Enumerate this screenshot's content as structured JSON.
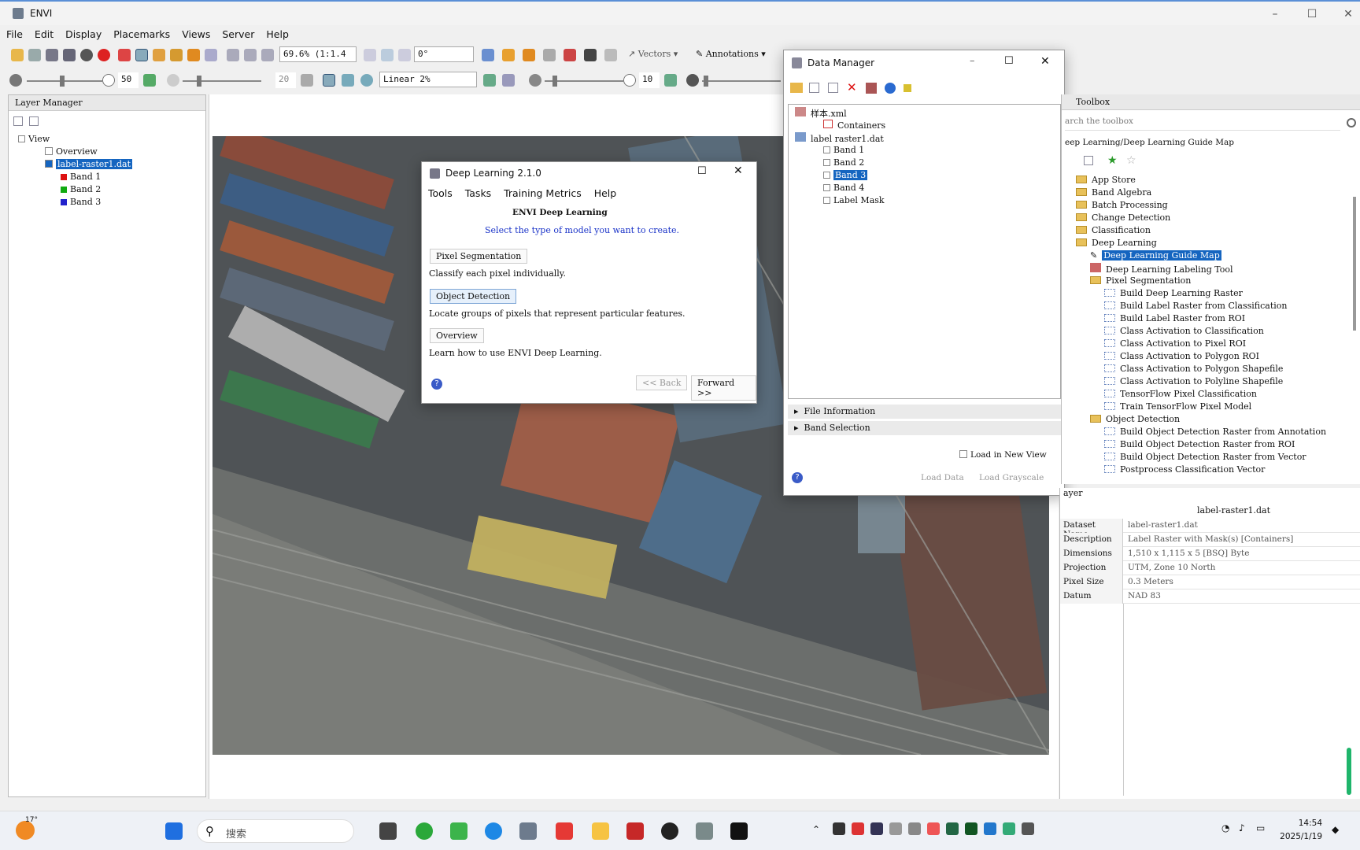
{
  "app": {
    "title": "ENVI"
  },
  "menu": [
    "File",
    "Edit",
    "Display",
    "Placemarks",
    "Views",
    "Server",
    "Help"
  ],
  "toolbar": {
    "zoom": "69.6% (1:1.4",
    "rotation": "0°",
    "vectors": "Vectors",
    "annotations": "Annotations",
    "brightness": "50",
    "contrast": "20",
    "stretch": "Linear 2%",
    "sharpen": "10"
  },
  "layer_manager": {
    "title": "Layer Manager",
    "items": [
      "View",
      "Overview",
      "label-raster1.dat",
      "Band 1",
      "Band 2",
      "Band 3"
    ],
    "band_colors": [
      "#d11",
      "#1a1",
      "#22c"
    ]
  },
  "deep_learning": {
    "title": "Deep Learning 2.1.0",
    "menu": [
      "Tools",
      "Tasks",
      "Training Metrics",
      "Help"
    ],
    "heading": "ENVI Deep Learning",
    "prompt": "Select the type of model you want to create.",
    "options": [
      {
        "label": "Pixel Segmentation",
        "desc": "Classify each pixel individually."
      },
      {
        "label": "Object Detection",
        "desc": "Locate groups of pixels that represent particular features."
      },
      {
        "label": "Overview",
        "desc": "Learn how to use ENVI Deep Learning."
      }
    ],
    "back": "<< Back",
    "forward": "Forward >>"
  },
  "data_manager": {
    "title": "Data Manager",
    "tree": [
      "样本.xml",
      "Containers",
      "label raster1.dat",
      "Band 1",
      "Band 2",
      "Band 3",
      "Band 4",
      "Label Mask"
    ],
    "sections": [
      "File Information",
      "Band Selection"
    ],
    "load_new_view": "Load in New View",
    "load_data": "Load Data",
    "load_grayscale": "Load Grayscale"
  },
  "toolbox": {
    "title": "Toolbox",
    "search_placeholder": "arch the toolbox",
    "path": "eep Learning/Deep Learning Guide Map",
    "folders": [
      "App Store",
      "Band Algebra",
      "Batch Processing",
      "Change Detection",
      "Classification",
      "Deep Learning"
    ],
    "dl_items": [
      "Deep Learning Guide Map",
      "Deep Learning Labeling Tool"
    ],
    "pixel_seg": "Pixel Segmentation",
    "pixel_seg_tools": [
      "Build Deep Learning Raster",
      "Build Label Raster from Classification",
      "Build Label Raster from ROI",
      "Class Activation to Classification",
      "Class Activation to Pixel ROI",
      "Class Activation to Polygon ROI",
      "Class Activation to Polygon Shapefile",
      "Class Activation to Polyline Shapefile",
      "TensorFlow Pixel Classification",
      "Train TensorFlow Pixel Model"
    ],
    "obj_det": "Object Detection",
    "obj_det_tools": [
      "Build Object Detection Raster from Annotation",
      "Build Object Detection Raster from ROI",
      "Build Object Detection Raster from Vector",
      "Postprocess Classification Vector"
    ]
  },
  "layer_panel": {
    "title": "ayer",
    "name": "label-raster1.dat",
    "rows": [
      {
        "k": "Dataset Name",
        "v": "label-raster1.dat"
      },
      {
        "k": "Description",
        "v": "Label Raster with Mask(s) [Containers]"
      },
      {
        "k": "Dimensions",
        "v": "1,510 x 1,115 x 5 [BSQ] Byte"
      },
      {
        "k": "Projection",
        "v": "UTM, Zone 10 North"
      },
      {
        "k": "Pixel Size",
        "v": "0.3 Meters"
      },
      {
        "k": "Datum",
        "v": "NAD 83"
      }
    ]
  },
  "taskbar": {
    "weather": "17°",
    "search": "搜索",
    "time": "14:54",
    "date": "2025/1/19"
  }
}
